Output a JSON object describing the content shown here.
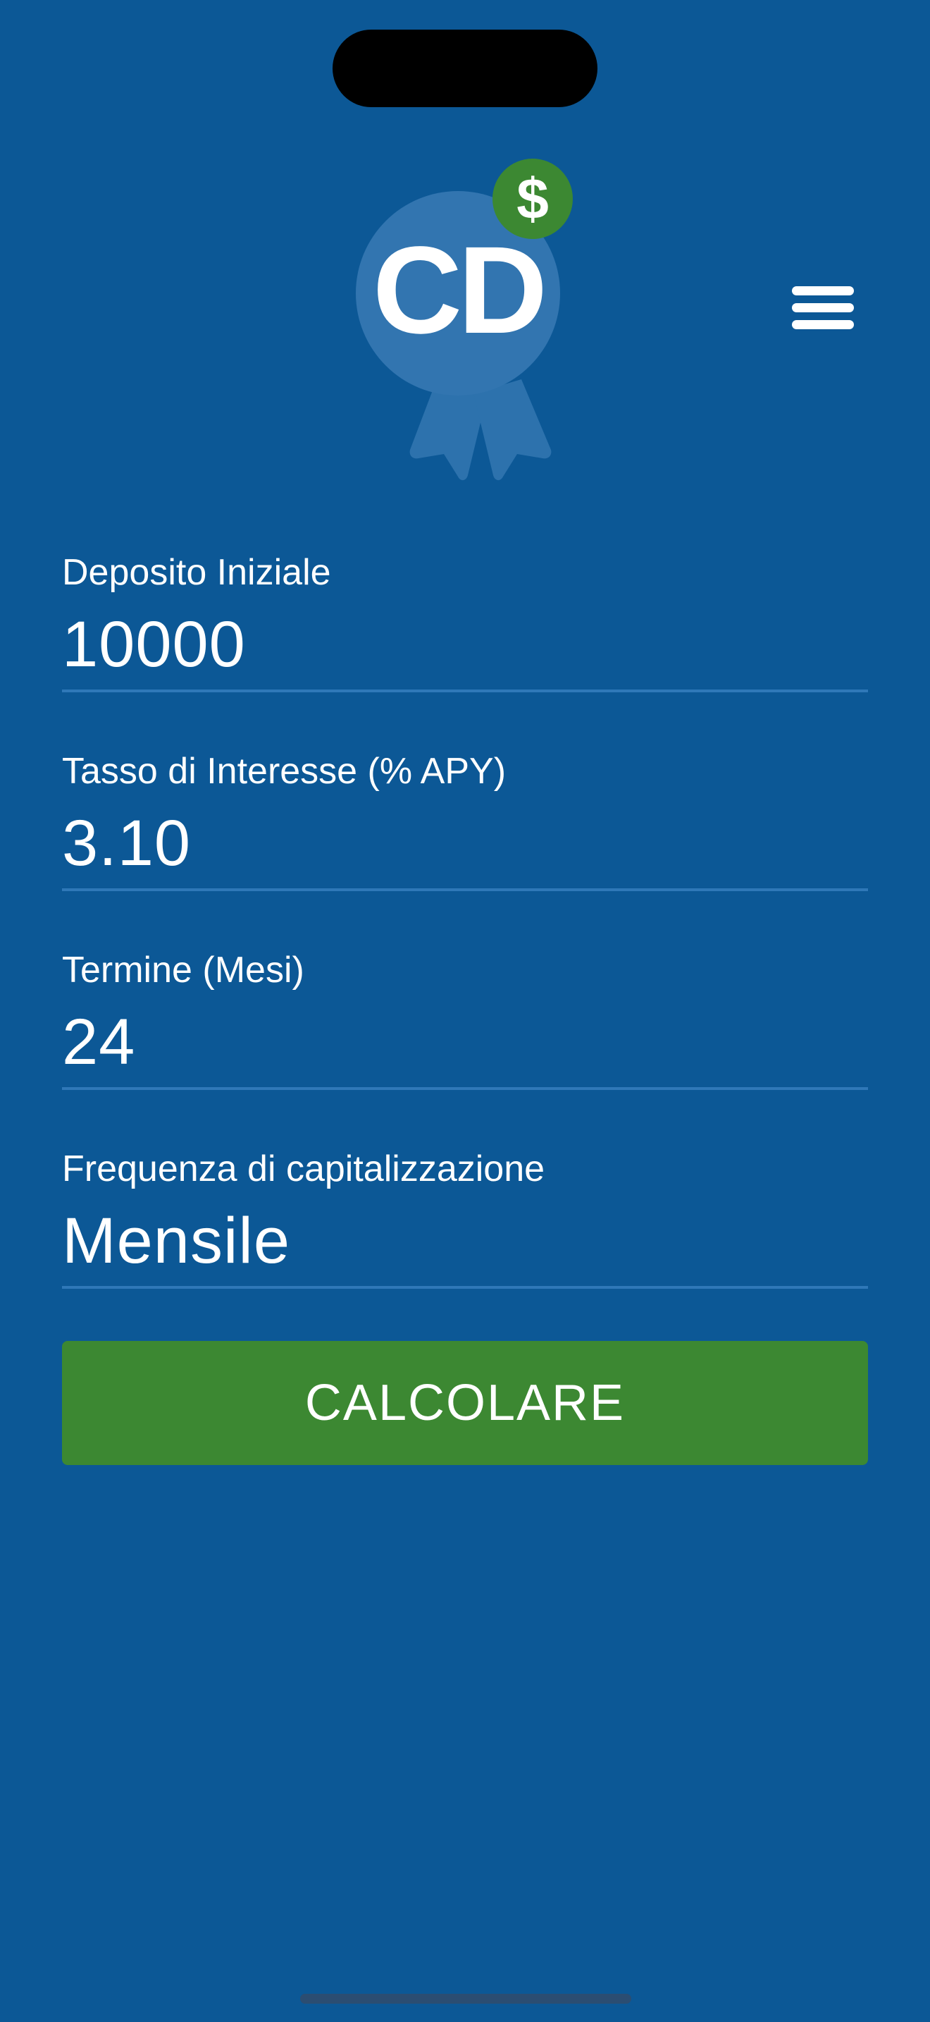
{
  "app": {
    "logo_text": "CD",
    "logo_badge_symbol": "$"
  },
  "colors": {
    "background": "#0c5896",
    "button": "#3c8832",
    "badge": "#3c8832",
    "underline": "#2f78b8"
  },
  "icons": {
    "menu": "hamburger-menu-icon",
    "logo": "cd-ribbon-logo-icon"
  },
  "form": {
    "initial_deposit": {
      "label": "Deposito Iniziale",
      "value": "10000"
    },
    "interest_rate": {
      "label": "Tasso di Interesse (% APY)",
      "value": "3.10"
    },
    "term": {
      "label": "Termine (Mesi)",
      "value": "24"
    },
    "compounding": {
      "label": "Frequenza di capitalizzazione",
      "value": "Mensile"
    }
  },
  "actions": {
    "calculate_label": "CALCOLARE"
  }
}
